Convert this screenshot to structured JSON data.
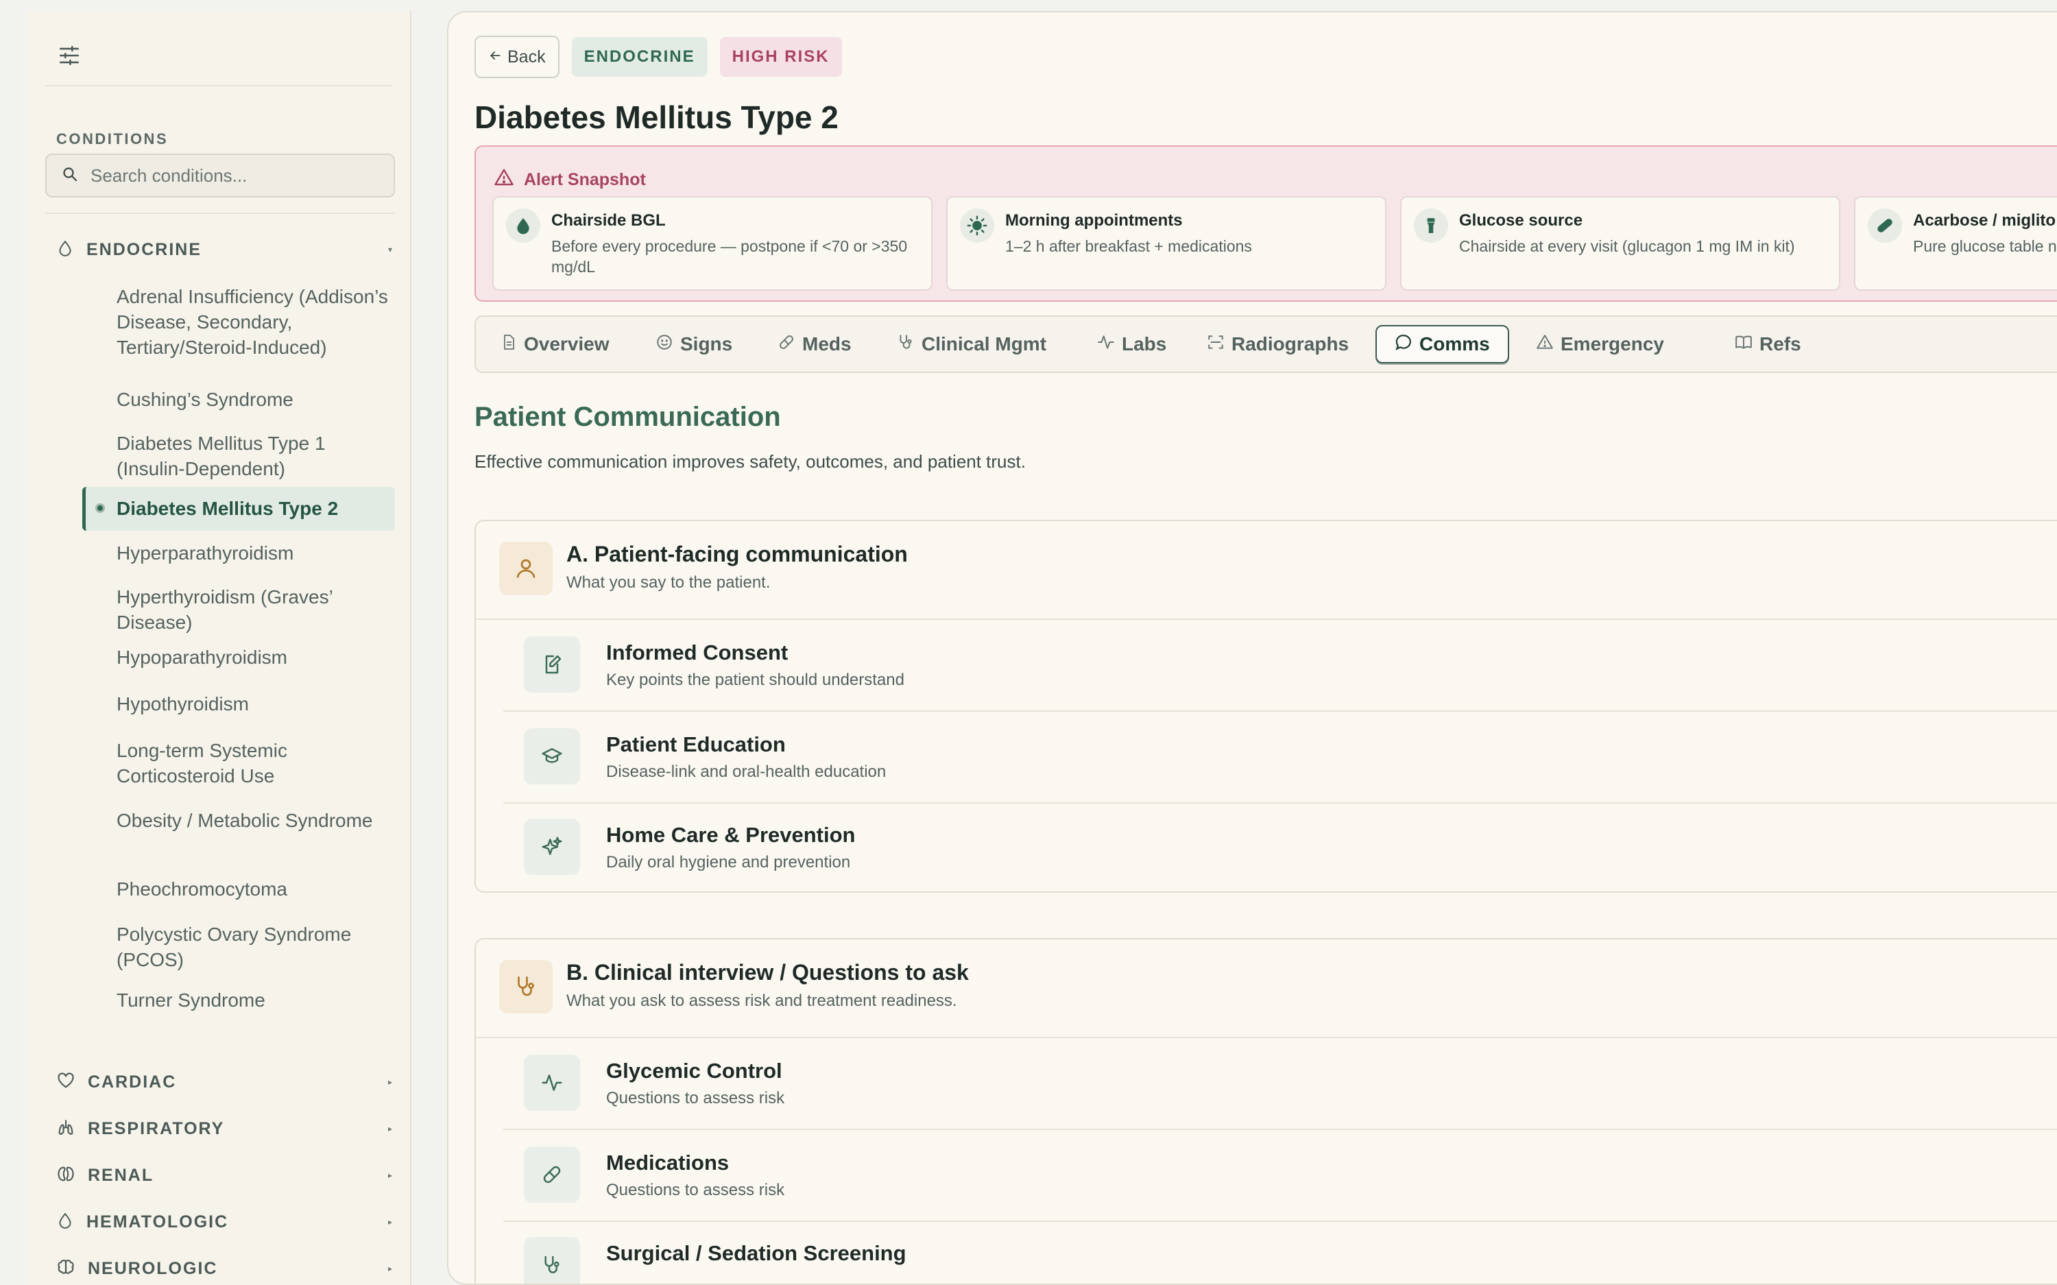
{
  "sidebar": {
    "heading": "CONDITIONS",
    "search_placeholder": "Search conditions...",
    "categories": [
      {
        "label": "ENDOCRINE"
      },
      {
        "label": "CARDIAC"
      },
      {
        "label": "RESPIRATORY"
      },
      {
        "label": "RENAL"
      },
      {
        "label": "HEMATOLOGIC"
      },
      {
        "label": "NEUROLOGIC"
      }
    ],
    "conditions": [
      "Adrenal Insufficiency (Addison’s Disease, Secondary, Tertiary/Steroid-Induced)",
      "Cushing’s Syndrome",
      "Diabetes Mellitus Type 1 (Insulin-Dependent)",
      "Diabetes Mellitus Type 2",
      "Hyperparathyroidism",
      "Hyperthyroidism (Graves’ Disease)",
      "Hypoparathyroidism",
      "Hypothyroidism",
      "Long-term Systemic Corticosteroid Use",
      "Obesity / Metabolic Syndrome",
      "Pheochromocytoma",
      "Polycystic Ovary Syndrome (PCOS)",
      "Turner Syndrome"
    ]
  },
  "header": {
    "back_label": "Back",
    "category_pill": "ENDOCRINE",
    "risk_pill": "HIGH RISK",
    "title": "Diabetes Mellitus Type 2"
  },
  "alert": {
    "title": "Alert Snapshot",
    "items": [
      {
        "icon": "drop-icon",
        "title": "Chairside BGL",
        "desc": "Before every procedure — postpone if <70 or >350 mg/dL"
      },
      {
        "icon": "sun-icon",
        "title": "Morning appointments",
        "desc": "1–2 h after breakfast + medications"
      },
      {
        "icon": "flashlight-icon",
        "title": "Glucose source",
        "desc": "Chairside at every visit (glucagon 1 mg IM in kit)"
      },
      {
        "icon": "pill-icon",
        "title": "Acarbose / miglito",
        "desc": "Pure glucose table not work"
      }
    ]
  },
  "tabs": [
    {
      "label": "Overview",
      "icon": "document-icon"
    },
    {
      "label": "Signs",
      "icon": "smile-icon"
    },
    {
      "label": "Meds",
      "icon": "pill-icon"
    },
    {
      "label": "Clinical Mgmt",
      "icon": "stethoscope-icon"
    },
    {
      "label": "Labs",
      "icon": "activity-icon"
    },
    {
      "label": "Radiographs",
      "icon": "scan-icon"
    },
    {
      "label": "Comms",
      "icon": "message-icon"
    },
    {
      "label": "Emergency",
      "icon": "warning-icon"
    },
    {
      "label": "Refs",
      "icon": "book-icon"
    }
  ],
  "active_tab": "Comms",
  "section": {
    "title": "Patient Communication",
    "subtitle": "Effective communication improves safety, outcomes, and patient trust."
  },
  "cards": [
    {
      "title": "A. Patient-facing communication",
      "subtitle": "What you say to the patient.",
      "icon": "person-icon",
      "items": [
        {
          "title": "Informed Consent",
          "subtitle": "Key points the patient should understand",
          "icon": "edit-document-icon"
        },
        {
          "title": "Patient Education",
          "subtitle": "Disease-link and oral-health education",
          "icon": "graduation-cap-icon"
        },
        {
          "title": "Home Care & Prevention",
          "subtitle": "Daily oral hygiene and prevention",
          "icon": "sparkles-icon"
        }
      ]
    },
    {
      "title": "B. Clinical interview / Questions to ask",
      "subtitle": "What you ask to assess risk and treatment readiness.",
      "icon": "stethoscope-icon",
      "items": [
        {
          "title": "Glycemic Control",
          "subtitle": "Questions to assess risk",
          "icon": "activity-icon"
        },
        {
          "title": "Medications",
          "subtitle": "Questions to assess risk",
          "icon": "pill-icon"
        },
        {
          "title": "Surgical / Sedation Screening",
          "subtitle": "",
          "icon": "stethoscope-icon"
        }
      ]
    }
  ],
  "colors": {
    "accent_green": "#2f6852",
    "risk_pink": "#a8445f",
    "alert_bg": "#f7e6e8",
    "page_bg": "#faf8f1"
  }
}
